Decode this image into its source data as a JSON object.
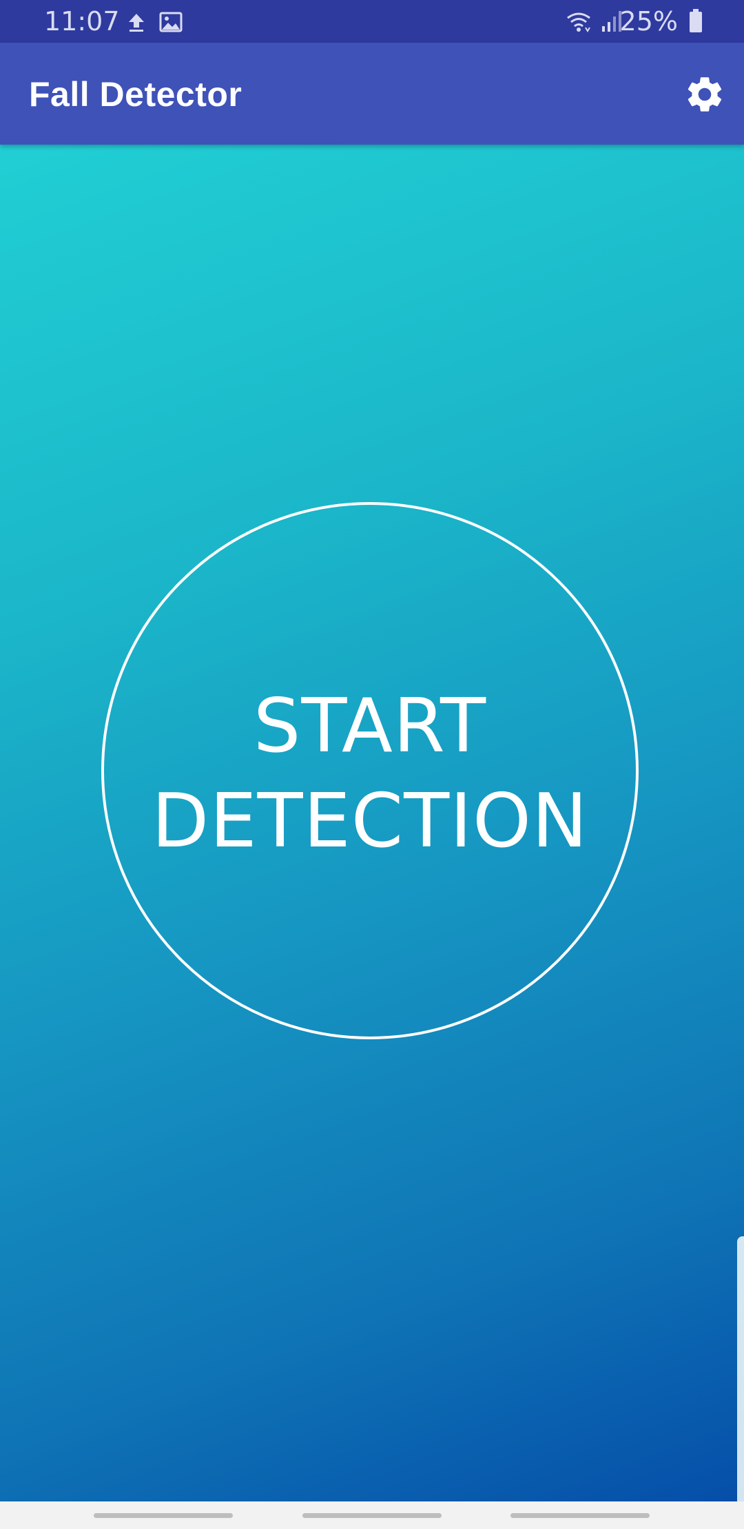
{
  "status_bar": {
    "time": "11:07",
    "battery_text": "25%",
    "icons": [
      "upload-icon",
      "image-icon",
      "wifi-icon",
      "signal-icon",
      "battery-icon"
    ]
  },
  "app_bar": {
    "title": "Fall Detector",
    "settings_icon": "gear-icon"
  },
  "main": {
    "button_line1": "START",
    "button_line2": "DETECTION"
  },
  "colors": {
    "status_bar": "#2f3a9f",
    "app_bar": "#3e52b8",
    "gradient_top": "#21cfd4",
    "gradient_bottom": "#054ea9"
  }
}
